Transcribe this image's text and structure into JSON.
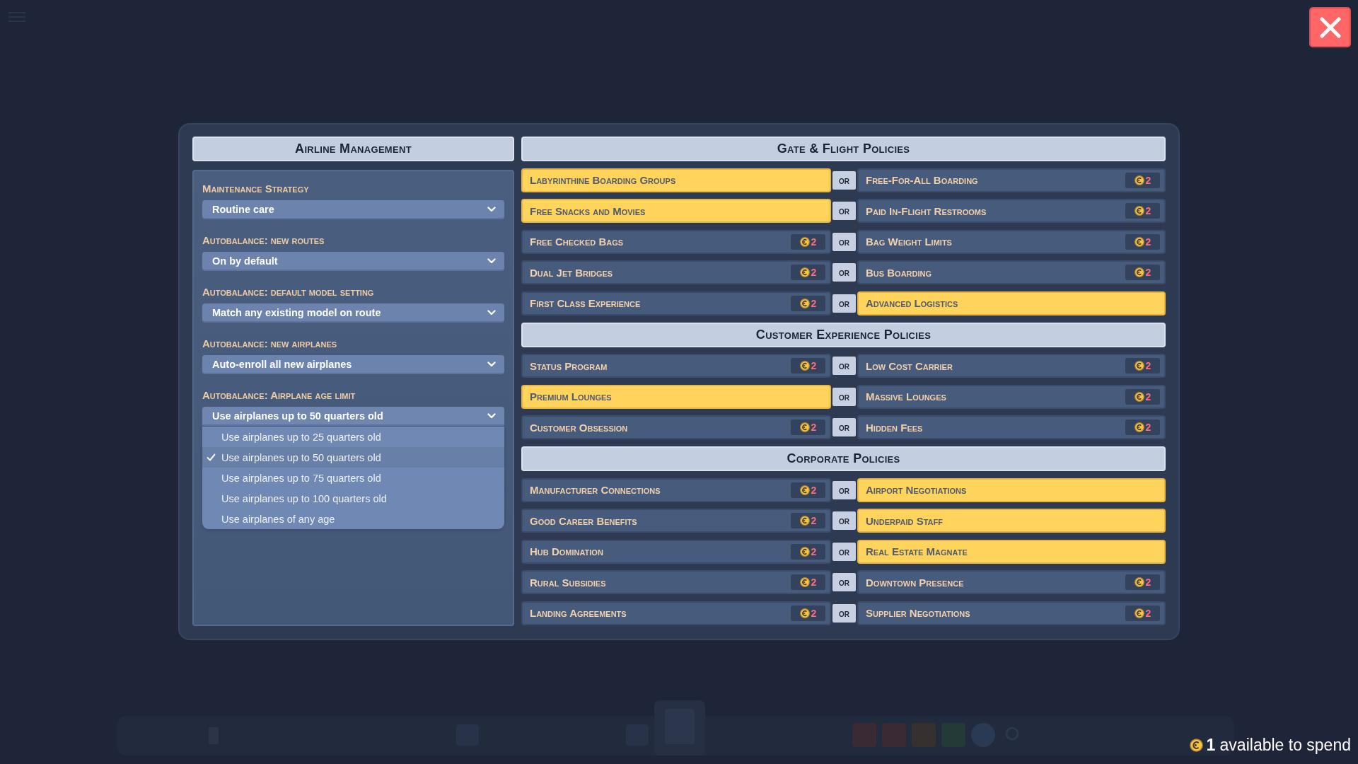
{
  "airline_management": {
    "title": "Airline Management",
    "settings": [
      {
        "label": "Maintenance Strategy",
        "value": "Routine care",
        "expanded": false
      },
      {
        "label": "Autobalance: new routes",
        "value": "On by default",
        "expanded": false
      },
      {
        "label": "Autobalance: default model setting",
        "value": "Match any existing model on route",
        "expanded": false
      },
      {
        "label": "Autobalance: new airplanes",
        "value": "Auto-enroll all new airplanes",
        "expanded": false
      },
      {
        "label": "Autobalance: Airplane age limit",
        "value": "Use airplanes up to 50 quarters old",
        "expanded": true,
        "options": [
          {
            "label": "Use airplanes up to 25 quarters old",
            "selected": false
          },
          {
            "label": "Use airplanes up to 50 quarters old",
            "selected": true
          },
          {
            "label": "Use airplanes up to 75 quarters old",
            "selected": false
          },
          {
            "label": "Use airplanes up to 100 quarters old",
            "selected": false
          },
          {
            "label": "Use airplanes of any age",
            "selected": false
          }
        ]
      }
    ]
  },
  "policy_sections": [
    {
      "title": "Gate & Flight Policies",
      "pairs": [
        {
          "options": [
            {
              "name": "Labyrinthine Boarding Groups",
              "selected": true
            },
            {
              "name": "Free-For-All Boarding",
              "selected": false,
              "cost": "2"
            }
          ],
          "separator": "or"
        },
        {
          "options": [
            {
              "name": "Free Snacks and Movies",
              "selected": true
            },
            {
              "name": "Paid In-Flight Restrooms",
              "selected": false,
              "cost": "2"
            }
          ],
          "separator": "or"
        },
        {
          "options": [
            {
              "name": "Free Checked Bags",
              "selected": false,
              "cost": "2"
            },
            {
              "name": "Bag Weight Limits",
              "selected": false,
              "cost": "2"
            }
          ],
          "separator": "or"
        },
        {
          "options": [
            {
              "name": "Dual Jet Bridges",
              "selected": false,
              "cost": "2"
            },
            {
              "name": "Bus Boarding",
              "selected": false,
              "cost": "2"
            }
          ],
          "separator": "or"
        },
        {
          "options": [
            {
              "name": "First Class Experience",
              "selected": false,
              "cost": "2"
            },
            {
              "name": "Advanced Logistics",
              "selected": true
            }
          ],
          "separator": "or"
        }
      ]
    },
    {
      "title": "Customer Experience Policies",
      "pairs": [
        {
          "options": [
            {
              "name": "Status Program",
              "selected": false,
              "cost": "2"
            },
            {
              "name": "Low Cost Carrier",
              "selected": false,
              "cost": "2"
            }
          ],
          "separator": "or"
        },
        {
          "options": [
            {
              "name": "Premium Lounges",
              "selected": true
            },
            {
              "name": "Massive Lounges",
              "selected": false,
              "cost": "2"
            }
          ],
          "separator": "or"
        },
        {
          "options": [
            {
              "name": "Customer Obsession",
              "selected": false,
              "cost": "2"
            },
            {
              "name": "Hidden Fees",
              "selected": false,
              "cost": "2"
            }
          ],
          "separator": "or"
        }
      ]
    },
    {
      "title": "Corporate Policies",
      "pairs": [
        {
          "options": [
            {
              "name": "Manufacturer Connections",
              "selected": false,
              "cost": "2"
            },
            {
              "name": "Airport Negotiations",
              "selected": true
            }
          ],
          "separator": "or"
        },
        {
          "options": [
            {
              "name": "Good Career Benefits",
              "selected": false,
              "cost": "2"
            },
            {
              "name": "Underpaid Staff",
              "selected": true
            }
          ],
          "separator": "or"
        },
        {
          "options": [
            {
              "name": "Hub Domination",
              "selected": false,
              "cost": "2"
            },
            {
              "name": "Real Estate Magnate",
              "selected": true
            }
          ],
          "separator": "or"
        },
        {
          "options": [
            {
              "name": "Rural Subsidies",
              "selected": false,
              "cost": "2"
            },
            {
              "name": "Downtown Presence",
              "selected": false,
              "cost": "2"
            }
          ],
          "separator": "or"
        },
        {
          "options": [
            {
              "name": "Landing Agreements",
              "selected": false,
              "cost": "2"
            },
            {
              "name": "Supplier Negotiations",
              "selected": false,
              "cost": "2"
            }
          ],
          "separator": "or"
        }
      ]
    }
  ],
  "points_available": {
    "text": "**1** available to spend"
  }
}
